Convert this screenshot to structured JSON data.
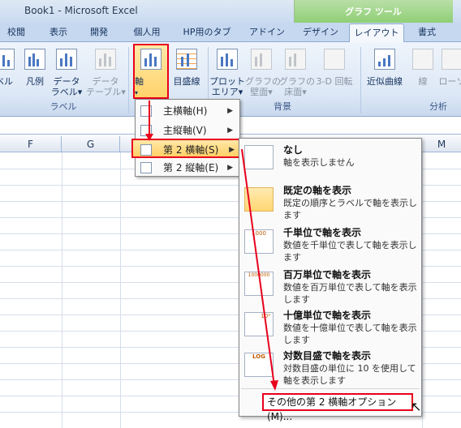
{
  "window": {
    "title": "Book1 - Microsoft Excel",
    "context_tab_group": "グラフ ツール"
  },
  "tabs": [
    "校閲",
    "表示",
    "開発",
    "個人用",
    "HP用のタブ",
    "アドイン",
    "デザイン",
    "レイアウト",
    "書式"
  ],
  "ribbon": {
    "group_label": {
      "buttons": [
        "ベル",
        "凡例",
        "データ\nラベル▾",
        "データ\nテーブル▾"
      ],
      "label": "ラベル"
    },
    "axis_group": {
      "axis": "軸",
      "gridlines": "目盛線"
    },
    "background_group": {
      "buttons": [
        "プロット\nエリア▾",
        "グラフの\n壁面▾",
        "グラフの\n床面▾",
        "3-D 回転"
      ],
      "label": "背景"
    },
    "analysis_group": {
      "buttons": [
        "近似曲線",
        "線",
        "ローソ"
      ],
      "label": "分析"
    }
  },
  "columns": [
    "F",
    "G",
    "M"
  ],
  "axis_menu": {
    "items": [
      {
        "label": "主横軸(H)",
        "accel": "H"
      },
      {
        "label": "主縦軸(V)",
        "accel": "V"
      },
      {
        "label": "第 2 横軸(S)",
        "accel": "S"
      },
      {
        "label": "第 2 縦軸(E)",
        "accel": "E"
      }
    ]
  },
  "secondary_axis_menu": {
    "options": [
      {
        "title": "なし",
        "desc": "軸を表示しません"
      },
      {
        "title": "既定の軸を表示",
        "desc": "既定の順序とラベルで軸を表示します"
      },
      {
        "title": "千単位で軸を表示",
        "desc": "数値を千単位で表して軸を表示します"
      },
      {
        "title": "百万単位で軸を表示",
        "desc": "数値を百万単位で表して軸を表示します"
      },
      {
        "title": "十億単位で軸を表示",
        "desc": "数値を十億単位で表して軸を表示します"
      },
      {
        "title": "対数目盛で軸を表示",
        "desc": "対数目盛の単位に 10 を使用して軸を表示します"
      }
    ],
    "more_options": "その他の第 2 横軸オプション(M)...",
    "icon_labels": [
      "1000",
      "1000000",
      "10⁹",
      "LOG"
    ]
  },
  "colors": {
    "highlight": "#ffd36b",
    "annotation": "#e8001c",
    "ribbon": "#dde8f6"
  }
}
